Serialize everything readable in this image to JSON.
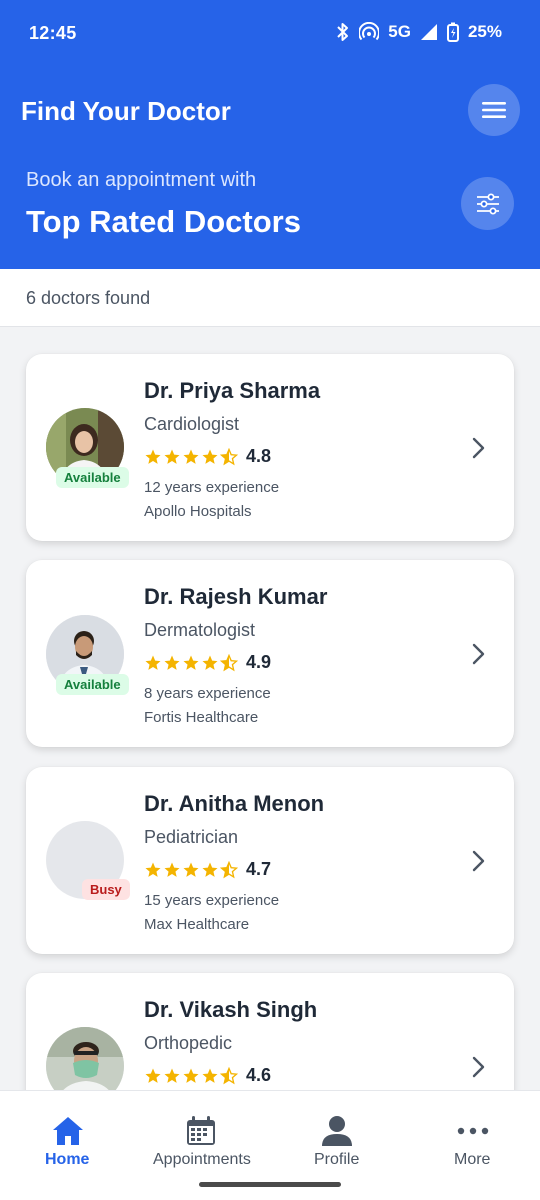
{
  "status_bar": {
    "time": "12:45",
    "network": "5G",
    "battery": "25%"
  },
  "header": {
    "title": "Find Your Doctor",
    "subtitle": "Book an appointment with",
    "hero": "Top Rated Doctors",
    "accent_color": "#2663e8"
  },
  "results": {
    "text": "6 doctors found"
  },
  "doctors": [
    {
      "name": "Dr. Priya Sharma",
      "specialty": "Cardiologist",
      "rating": "4.8",
      "experience": "12 years experience",
      "hospital": "Apollo Hospitals",
      "status": "Available"
    },
    {
      "name": "Dr. Rajesh Kumar",
      "specialty": "Dermatologist",
      "rating": "4.9",
      "experience": "8 years experience",
      "hospital": "Fortis Healthcare",
      "status": "Available"
    },
    {
      "name": "Dr. Anitha Menon",
      "specialty": "Pediatrician",
      "rating": "4.7",
      "experience": "15 years experience",
      "hospital": "Max Healthcare",
      "status": "Busy"
    },
    {
      "name": "Dr. Vikash Singh",
      "specialty": "Orthopedic",
      "rating": "4.6"
    }
  ],
  "nav": {
    "home": "Home",
    "appointments": "Appointments",
    "profile": "Profile",
    "more": "More"
  }
}
